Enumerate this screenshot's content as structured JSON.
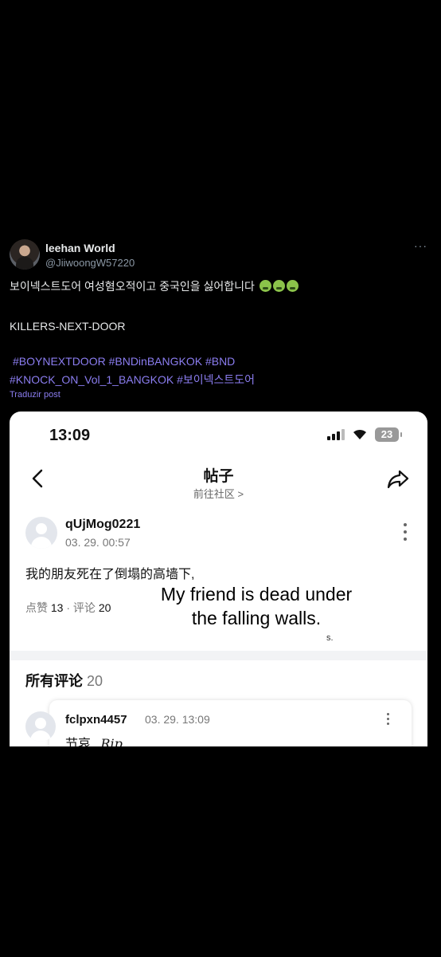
{
  "tweet": {
    "display_name": "leehan World",
    "handle": "@JiiwoongW57220",
    "more_label": "···",
    "korean_text": "보이넥스트도어 여성혐오적이고 중국인을 싫어합니다",
    "emoji": [
      "nauseated-face",
      "nauseated-face",
      "nauseated-face"
    ],
    "caption": "KILLERS-NEXT-DOOR",
    "hashtags_line1": "#BOYNEXTDOOR #BNDinBANGKOK #BND",
    "hashtags_line2": "#KNOCK_ON_Vol_1_BANGKOK #보이넥스트도어",
    "translate_label": "Traduzir post"
  },
  "screenshot": {
    "status_time": "13:09",
    "battery": "23",
    "nav_title": "帖子",
    "nav_subtitle": "前往社区 >",
    "post": {
      "username": "qUjMog0221",
      "date": "03. 29. 00:57",
      "text": "我的朋友死在了倒塌的高墙下,",
      "likes_label": "点赞",
      "likes_count": "13",
      "separator": "·",
      "comments_label": "评论",
      "comments_count": "20"
    },
    "overlay_translation_line1": "My friend is dead under",
    "overlay_translation_line2": "the falling walls.",
    "overlay_mark": "s.",
    "all_comments_label": "所有评论",
    "all_comments_count": "20",
    "comment": {
      "username": "fclpxn4457",
      "date": "03. 29. 13:09",
      "text": "节哀",
      "handwriting": "Rip"
    }
  },
  "colors": {
    "background": "#000000",
    "hashtag": "#8b7df0",
    "muted": "#8b98a5"
  }
}
